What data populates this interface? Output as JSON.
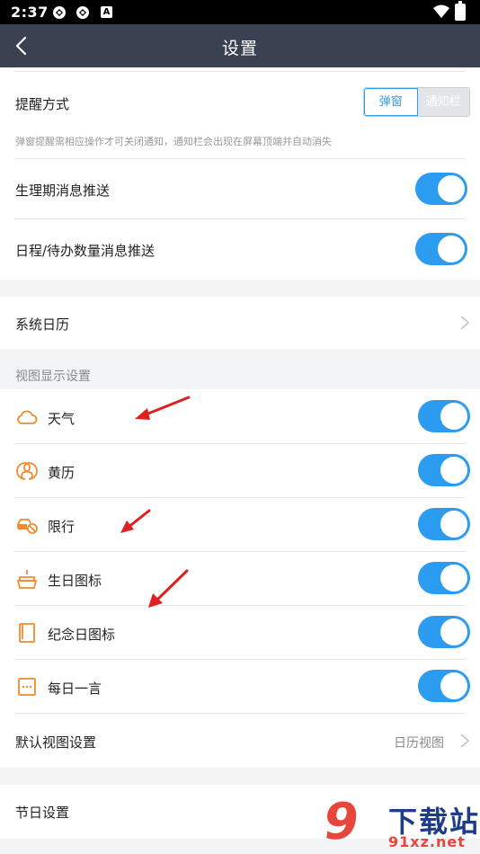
{
  "status_bar": {
    "time": "2:37",
    "badge": "A"
  },
  "header": {
    "title": "设置"
  },
  "notify": {
    "label": "提醒方式",
    "option_popup": "弹窗",
    "option_bar": "通知栏",
    "description": "弹窗提醒需相应操作才可关闭通知，通知栏会出现在屏幕顶端并自动消失"
  },
  "push": {
    "period_label": "生理期消息推送",
    "period_on": true,
    "schedule_label": "日程/待办数量消息推送",
    "schedule_on": true
  },
  "system_calendar": {
    "label": "系统日历"
  },
  "view_settings": {
    "title": "视图显示设置",
    "items": [
      {
        "label": "天气",
        "icon": "cloud-icon",
        "on": true
      },
      {
        "label": "黄历",
        "icon": "almanac-icon",
        "on": true
      },
      {
        "label": "限行",
        "icon": "car-restriction-icon",
        "on": true
      },
      {
        "label": "生日图标",
        "icon": "cake-icon",
        "on": true
      },
      {
        "label": "纪念日图标",
        "icon": "book-icon",
        "on": true
      },
      {
        "label": "每日一言",
        "icon": "quote-box-icon",
        "on": true
      }
    ],
    "default_view_label": "默认视图设置",
    "default_view_value": "日历视图"
  },
  "holiday": {
    "label": "节日设置"
  },
  "watermark": {
    "digits": "9",
    "text": "下载站",
    "url": "91xz.net"
  },
  "colors": {
    "accent": "#2c9cf0",
    "header": "#3a4150",
    "icon_orange": "#f28a30",
    "annotation_red": "#e02020"
  }
}
